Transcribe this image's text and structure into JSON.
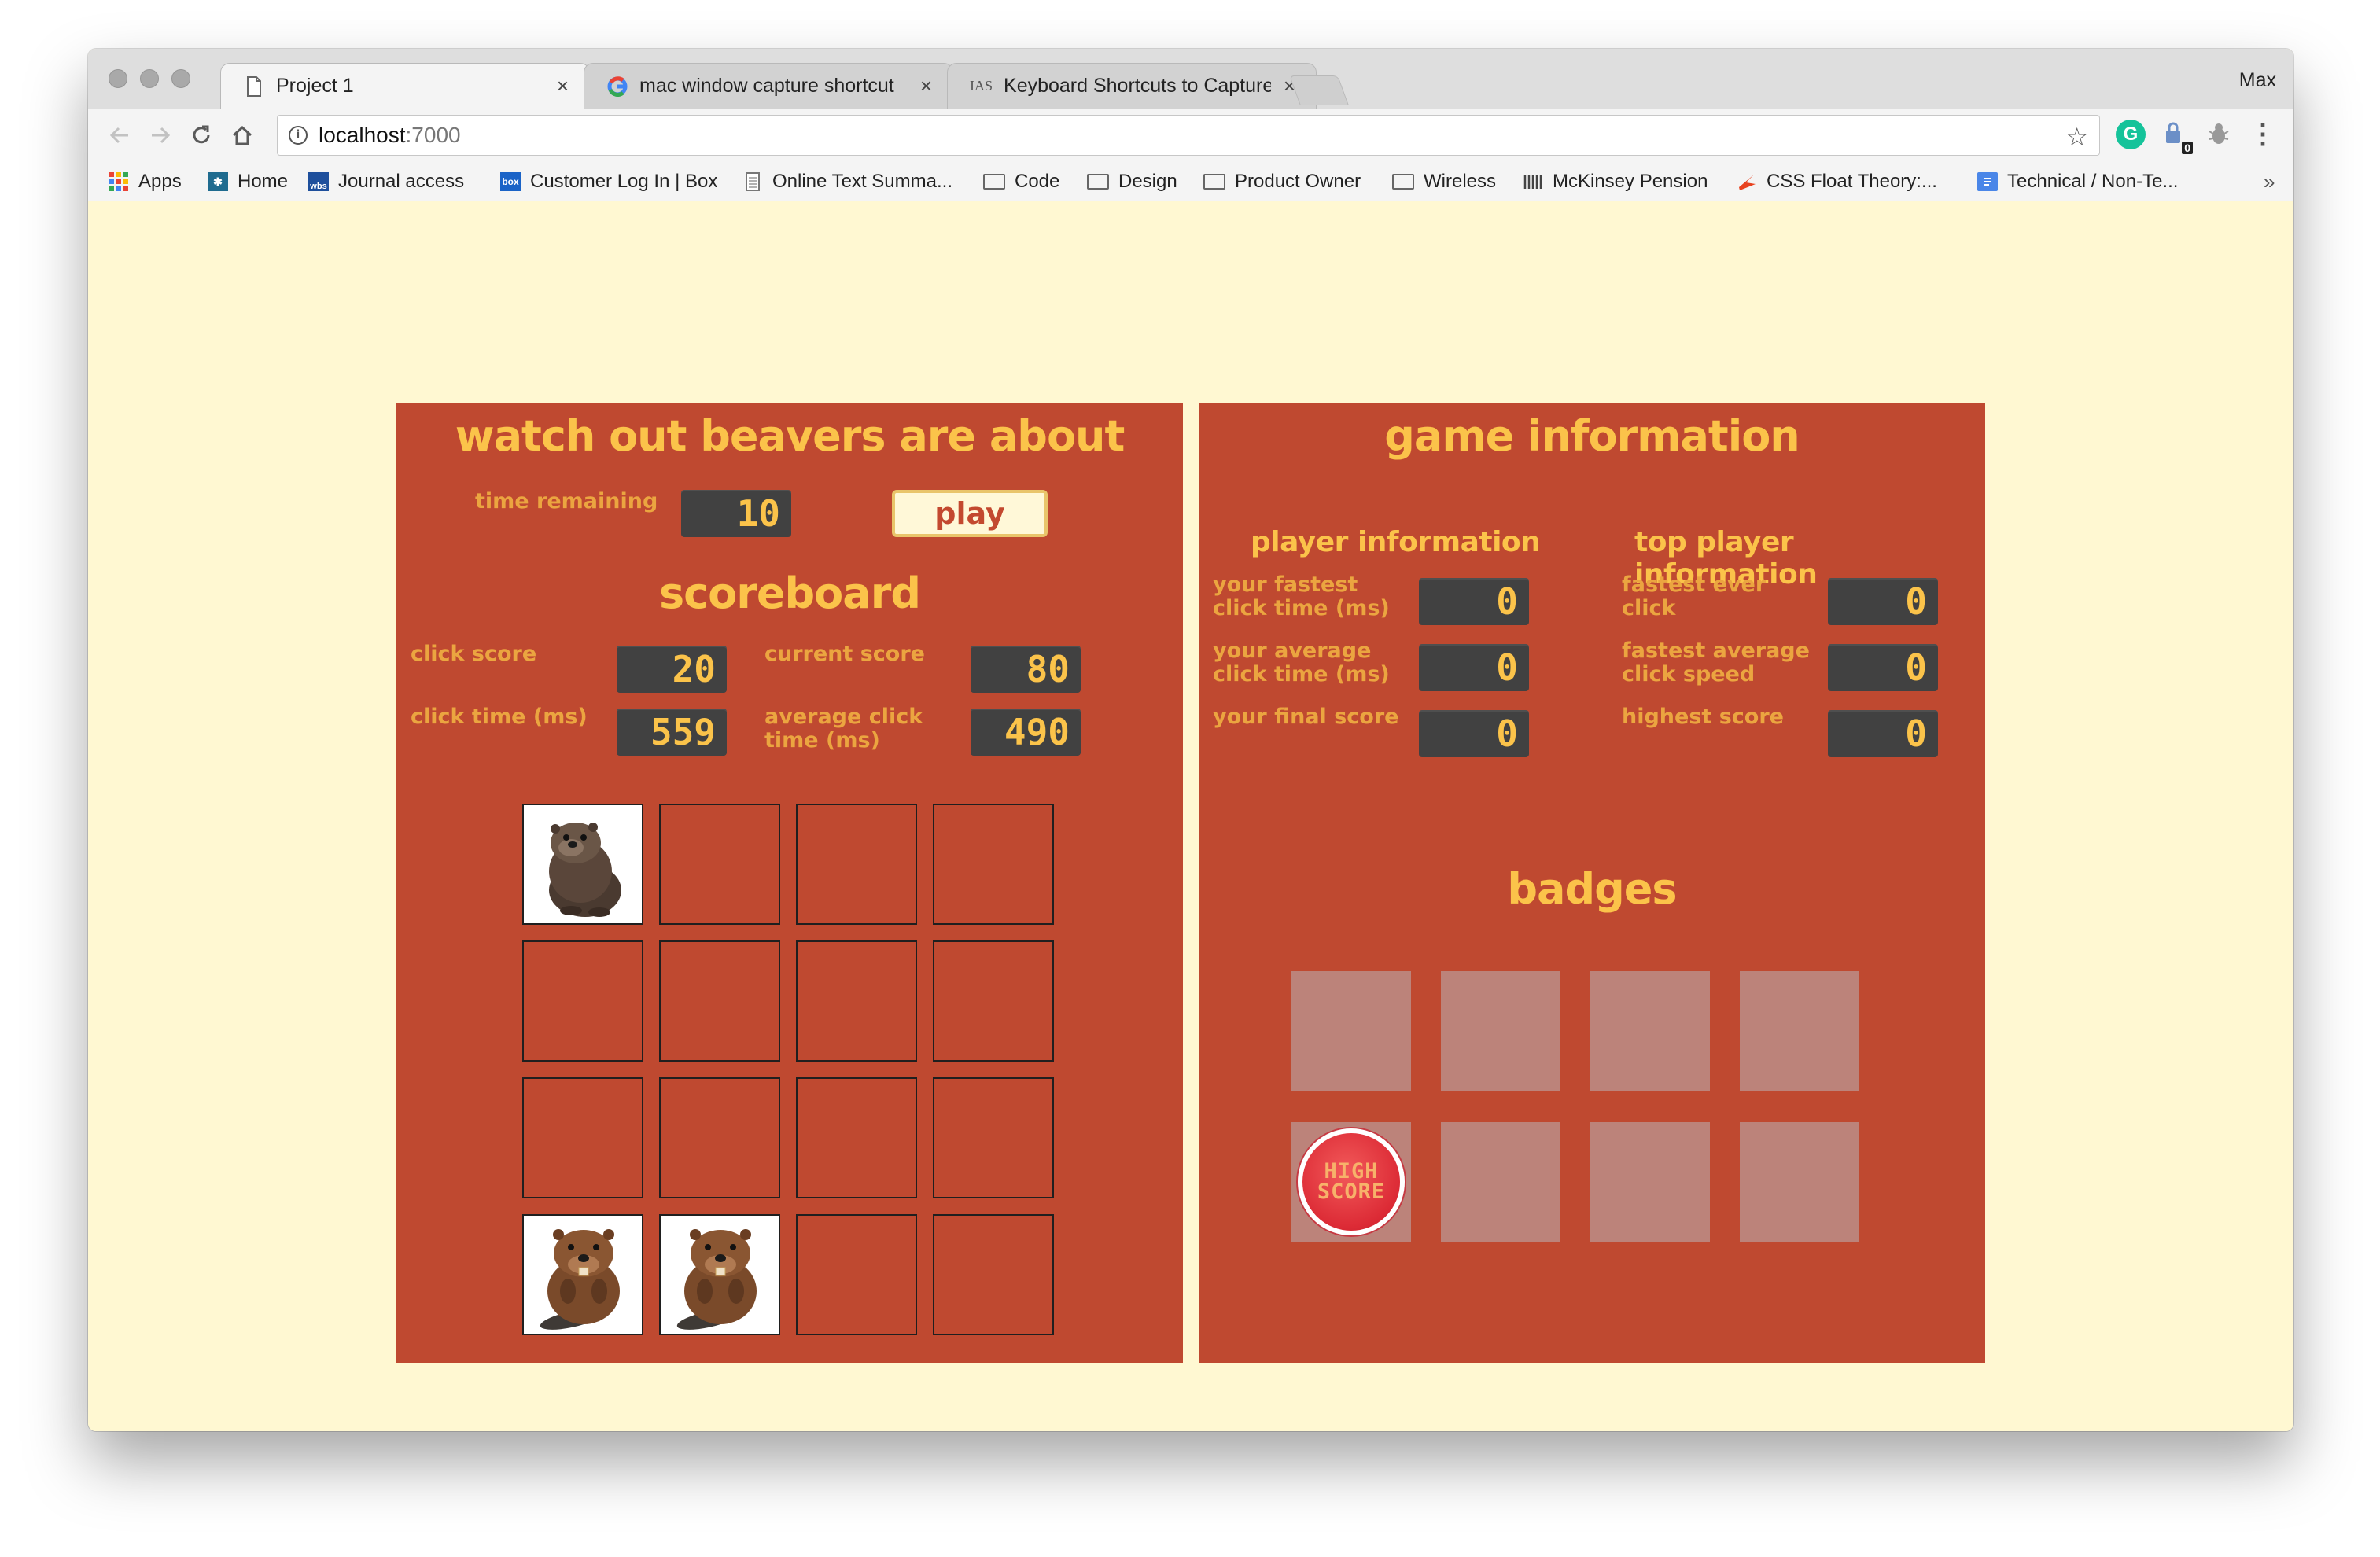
{
  "browser": {
    "profile_name": "Max",
    "tabs": [
      {
        "title": "Project 1",
        "icon": "page-icon",
        "close": "×"
      },
      {
        "title": "mac window capture shortcut",
        "icon": "google-icon",
        "close": "×"
      },
      {
        "title": "Keyboard Shortcuts to Capture",
        "icon": "IAS",
        "close": "×"
      }
    ],
    "url_host": "localhost",
    "url_port": ":7000",
    "bookmarks": [
      {
        "label": "Apps",
        "icon": "apps-grid-icon"
      },
      {
        "label": "Home",
        "icon": "home-bookmark-icon"
      },
      {
        "label": "Journal access",
        "icon": "wbs-icon",
        "icon_text": "wbs"
      },
      {
        "label": "Customer Log In | Box",
        "icon": "box-icon",
        "icon_text": "box"
      },
      {
        "label": "Online Text Summa...",
        "icon": "document-icon"
      },
      {
        "label": "Code",
        "icon": "folder-icon"
      },
      {
        "label": "Design",
        "icon": "folder-icon"
      },
      {
        "label": "Product Owner",
        "icon": "folder-icon"
      },
      {
        "label": "Wireless",
        "icon": "folder-icon"
      },
      {
        "label": "McKinsey Pension",
        "icon": "mckinsey-icon"
      },
      {
        "label": "CSS Float Theory:...",
        "icon": "css-icon"
      },
      {
        "label": "Technical / Non-Te...",
        "icon": "google-doc-icon"
      }
    ],
    "more_bookmarks": "»",
    "extension_badge": "0"
  },
  "game": {
    "title": "watch out beavers are about",
    "time_remaining_label": "time remaining",
    "time_remaining": "10",
    "play_label": "play",
    "scoreboard_title": "scoreboard",
    "click_score_label": "click score",
    "click_score": "20",
    "current_score_label": "current score",
    "current_score": "80",
    "click_time_label": "click time (ms)",
    "click_time": "559",
    "average_click_label": "average click time (ms)",
    "average_click": "490",
    "grid": [
      [
        "otter",
        "",
        "",
        ""
      ],
      [
        "",
        "",
        "",
        ""
      ],
      [
        "",
        "",
        "",
        ""
      ],
      [
        "beaver",
        "beaver",
        "",
        ""
      ]
    ]
  },
  "info": {
    "title": "game information",
    "player_title": "player information",
    "top_player_title": "top player information",
    "fastest_click_label": "your fastest click time (ms)",
    "fastest_click": "0",
    "average_click_label": "your average click time (ms)",
    "average_click": "0",
    "final_score_label": "your final score",
    "final_score": "0",
    "fastest_ever_label": "fastest ever click",
    "fastest_ever": "0",
    "fastest_average_label": "fastest average click speed",
    "fastest_average": "0",
    "highest_score_label": "highest score",
    "highest_score": "0",
    "badges_title": "badges",
    "badges": [
      "",
      "",
      "",
      "",
      "high score",
      "",
      "",
      ""
    ],
    "high_score_badge_text": "HIGH SCORE"
  },
  "colors": {
    "page_background": "#fff8d2",
    "panel": "#bf4930",
    "heading": "#fbc34a",
    "label": "#eba540",
    "counter_bg": "#414141",
    "badge_empty": "#bc837a"
  }
}
